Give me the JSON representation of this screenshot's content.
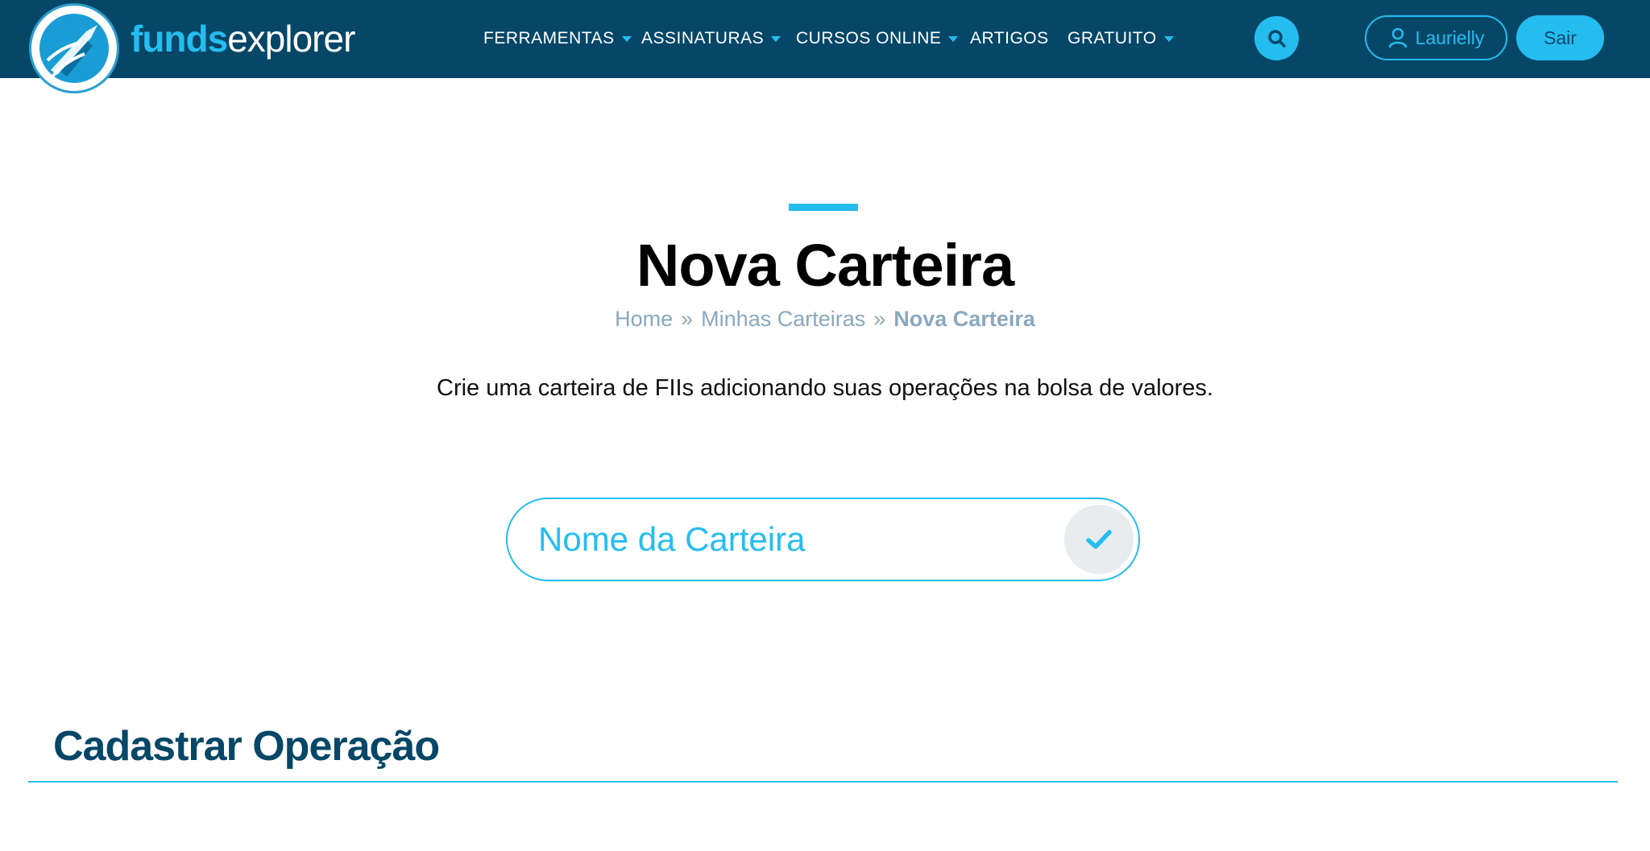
{
  "header": {
    "logo": {
      "part1": "funds",
      "part2": "explorer"
    },
    "nav": [
      {
        "label": "FERRAMENTAS",
        "has_dropdown": true
      },
      {
        "label": "ASSINATURAS",
        "has_dropdown": true
      },
      {
        "label": "CURSOS ONLINE",
        "has_dropdown": true
      },
      {
        "label": "ARTIGOS",
        "has_dropdown": false
      },
      {
        "label": "GRATUITO",
        "has_dropdown": true
      }
    ],
    "search_icon": "search-icon",
    "user": {
      "name": "Laurielly",
      "icon": "user-icon"
    },
    "logout_label": "Sair"
  },
  "main": {
    "title": "Nova Carteira",
    "breadcrumb": [
      {
        "label": "Home"
      },
      {
        "label": "Minhas Carteiras"
      },
      {
        "label": "Nova Carteira",
        "current": true
      }
    ],
    "breadcrumb_separator": "»",
    "description": "Crie uma carteira de FIIs adicionando suas operações na bolsa de valores.",
    "wallet_name": {
      "placeholder": "Nome da Carteira",
      "value": ""
    },
    "confirm_icon": "check-icon",
    "section_title": "Cadastrar Operação"
  },
  "colors": {
    "header_bg": "#064767",
    "accent": "#25bdf0",
    "breadcrumb": "#8aa8be",
    "section_title": "#064767",
    "confirm_bg": "#e8ecef"
  }
}
